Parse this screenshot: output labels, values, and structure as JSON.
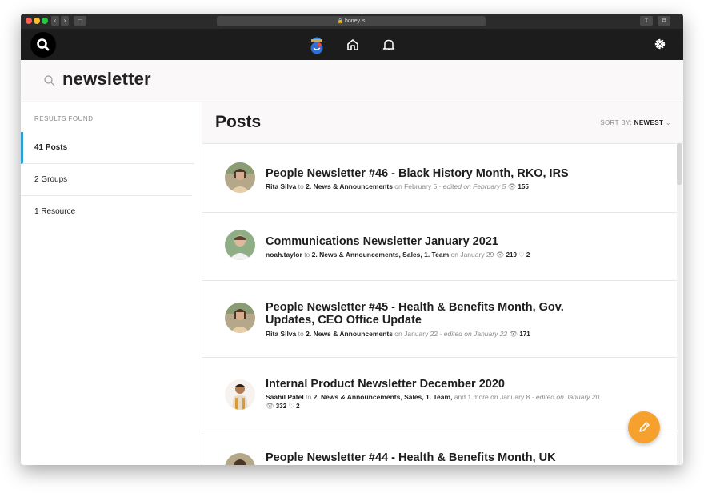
{
  "browser": {
    "url": "honey.is"
  },
  "search": {
    "query": "newsletter"
  },
  "sidebar": {
    "heading": "RESULTS FOUND",
    "items": [
      {
        "label": "41 Posts",
        "active": true
      },
      {
        "label": "2 Groups",
        "active": false
      },
      {
        "label": "1 Resource",
        "active": false
      }
    ]
  },
  "main": {
    "title": "Posts",
    "sort_label": "SORT BY:",
    "sort_value": "NEWEST"
  },
  "posts": [
    {
      "title": "People Newsletter #46 - Black History Month, RKO, IRS",
      "author": "Rita Silva",
      "to": "to",
      "groups": "2. News & Announcements",
      "date": "on February 5 ·",
      "edited": "edited on February 5",
      "views": "155",
      "likes": ""
    },
    {
      "title": "Communications Newsletter January 2021",
      "author": "noah.taylor",
      "to": "to",
      "groups": "2. News & Announcements, Sales, 1. Team",
      "date": "on January 29",
      "edited": "",
      "views": "219",
      "likes": "2"
    },
    {
      "title": "People Newsletter #45 - Health & Benefits Month, Gov. Updates, CEO Office Update",
      "author": "Rita Silva",
      "to": "to",
      "groups": "2. News & Announcements",
      "date": "on January 22 ·",
      "edited": "edited on January 22",
      "views": "171",
      "likes": ""
    },
    {
      "title": "Internal Product Newsletter December 2020",
      "author": "Saahil Patel",
      "to": "to",
      "groups": "2. News & Announcements, Sales, 1. Team,",
      "date": "and 1 more on January 8 ·",
      "edited": "edited on January 20",
      "views": "332",
      "likes": "2"
    },
    {
      "title": "People Newsletter #44 - Health & Benefits Month, UK",
      "author": "",
      "to": "",
      "groups": "",
      "date": "",
      "edited": "",
      "views": "",
      "likes": ""
    }
  ],
  "colors": {
    "accent": "#2a9fd6",
    "fab": "#f6a02d",
    "appbar": "#1c1c1c"
  },
  "icons": [
    "search-icon",
    "home-icon",
    "bell-icon",
    "gear-icon",
    "pencil-icon",
    "eye-icon",
    "heart-icon"
  ]
}
